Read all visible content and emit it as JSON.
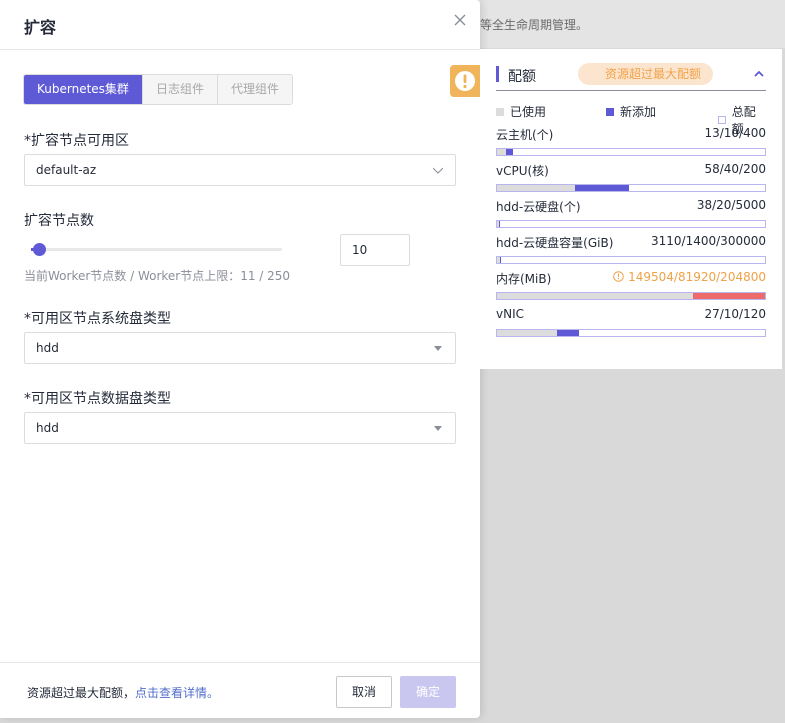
{
  "background": {
    "text": "等全生命周期管理。"
  },
  "drawer": {
    "title": "扩容",
    "tabs": [
      {
        "label": "Kubernetes集群",
        "active": true
      },
      {
        "label": "日志组件",
        "active": false
      },
      {
        "label": "代理组件",
        "active": false
      }
    ],
    "zone_label": "*扩容节点可用区",
    "zone_value": "default-az",
    "count_label": "扩容节点数",
    "count_value": "10",
    "count_slider_fraction": 0.03,
    "count_hint": "当前Worker节点数 / Worker节点上限：11 / 250",
    "sys_disk_label": "*可用区节点系统盘类型",
    "sys_disk_value": "hdd",
    "data_disk_label": "*可用区节点数据盘类型",
    "data_disk_value": "hdd",
    "footer_msg": "资源超过最大配额，",
    "footer_link": "点击查看详情。",
    "cancel_label": "取消",
    "ok_label": "确定"
  },
  "quota": {
    "title": "配额",
    "badge": "资源超过最大配额",
    "legend": {
      "used": "已使用",
      "new": "新添加",
      "total": "总配额"
    },
    "colors": {
      "accent": "#5e5ad6",
      "used": "#dcdcdc",
      "over": "#ec6a6a",
      "warn": "#f0a248"
    },
    "rows": [
      {
        "name": "云主机(个)",
        "value": "13/10/400",
        "used": 13,
        "added": 10,
        "total": 400,
        "warn": false
      },
      {
        "name": "vCPU(核)",
        "value": "58/40/200",
        "used": 58,
        "added": 40,
        "total": 200,
        "warn": false
      },
      {
        "name": "hdd-云硬盘(个)",
        "value": "38/20/5000",
        "used": 38,
        "added": 20,
        "total": 5000,
        "warn": false
      },
      {
        "name": "hdd-云硬盘容量(GiB)",
        "value": "3110/1400/300000",
        "used": 3110,
        "added": 1400,
        "total": 300000,
        "warn": false
      },
      {
        "name": "内存(MiB)",
        "value": "149504/81920/204800",
        "used": 149504,
        "added": 81920,
        "total": 204800,
        "warn": true
      },
      {
        "name": "vNIC",
        "value": "27/10/120",
        "used": 27,
        "added": 10,
        "total": 120,
        "warn": false
      }
    ]
  }
}
